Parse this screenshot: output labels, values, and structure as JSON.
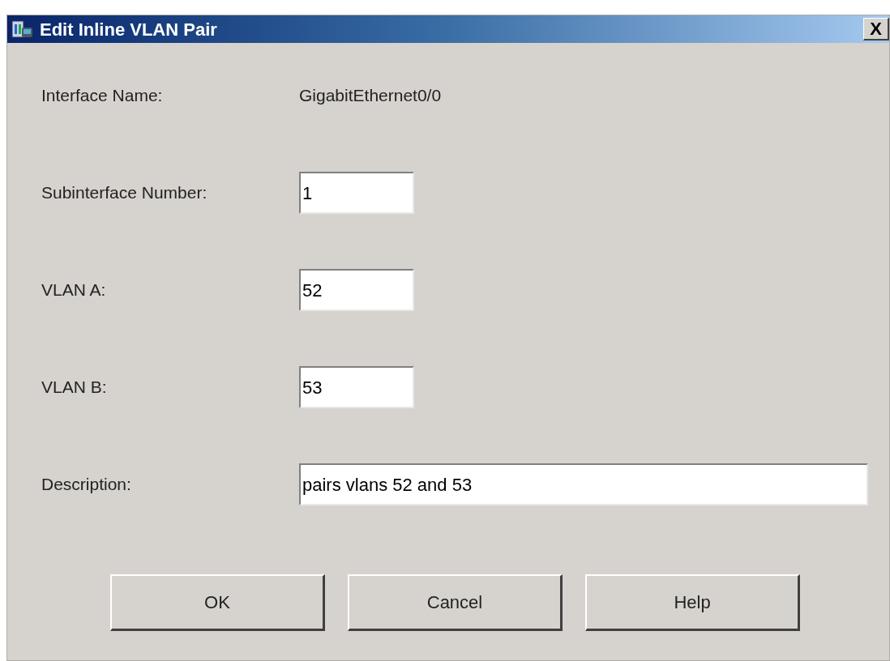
{
  "window": {
    "title": "Edit Inline VLAN Pair",
    "close": "X"
  },
  "fields": [
    {
      "kind": "text",
      "label": "Interface Name:",
      "value": "GigabitEthernet0/0"
    },
    {
      "kind": "input",
      "label": "Subinterface Number:",
      "value": "1"
    },
    {
      "kind": "input",
      "label": "VLAN A:",
      "value": "52"
    },
    {
      "kind": "input",
      "label": "VLAN B:",
      "value": "53"
    },
    {
      "kind": "wide",
      "label": "Description:",
      "value": "pairs vlans 52 and 53"
    }
  ],
  "buttons": [
    "OK",
    "Cancel",
    "Help"
  ]
}
